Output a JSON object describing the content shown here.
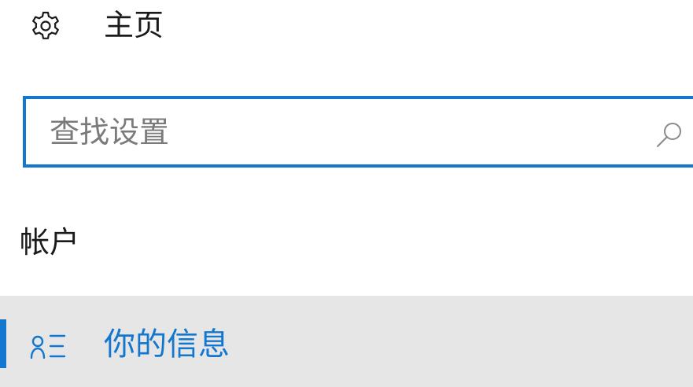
{
  "colors": {
    "accent": "#1477cf",
    "selected_background": "#e6e6e6",
    "text": "#1a1a1a",
    "placeholder": "#7a7a7a"
  },
  "home": {
    "icon": "gear-icon",
    "label": "主页"
  },
  "search": {
    "placeholder": "查找设置",
    "value": "",
    "icon": "search-icon"
  },
  "section": {
    "title": "帐户"
  },
  "nav": {
    "items": [
      {
        "icon": "person-list-icon",
        "label": "你的信息",
        "selected": true
      }
    ]
  }
}
